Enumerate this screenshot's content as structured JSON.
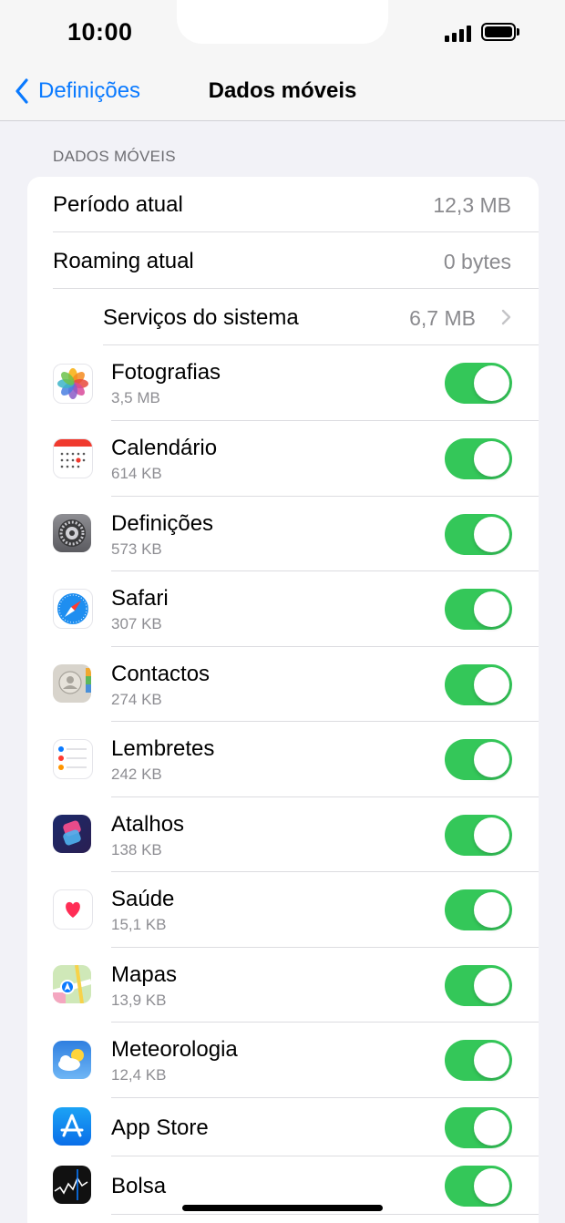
{
  "status": {
    "time": "10:00"
  },
  "nav": {
    "back_label": "Definições",
    "title": "Dados móveis"
  },
  "section": {
    "header": "DADOS MÓVEIS"
  },
  "summary": [
    {
      "label": "Período atual",
      "value": "12,3 MB"
    },
    {
      "label": "Roaming atual",
      "value": "0 bytes"
    }
  ],
  "system_services": {
    "label": "Serviços do sistema",
    "value": "6,7 MB"
  },
  "apps": [
    {
      "name": "Fotografias",
      "size": "3,5 MB",
      "icon": "photos-icon",
      "enabled": true
    },
    {
      "name": "Calendário",
      "size": "614 KB",
      "icon": "calendar-icon",
      "enabled": true
    },
    {
      "name": "Definições",
      "size": "573 KB",
      "icon": "settings-icon",
      "enabled": true
    },
    {
      "name": "Safari",
      "size": "307 KB",
      "icon": "safari-icon",
      "enabled": true
    },
    {
      "name": "Contactos",
      "size": "274 KB",
      "icon": "contacts-icon",
      "enabled": true
    },
    {
      "name": "Lembretes",
      "size": "242 KB",
      "icon": "reminders-icon",
      "enabled": true
    },
    {
      "name": "Atalhos",
      "size": "138 KB",
      "icon": "shortcuts-icon",
      "enabled": true
    },
    {
      "name": "Saúde",
      "size": "15,1 KB",
      "icon": "health-icon",
      "enabled": true
    },
    {
      "name": "Mapas",
      "size": "13,9 KB",
      "icon": "maps-icon",
      "enabled": true
    },
    {
      "name": "Meteorologia",
      "size": "12,4 KB",
      "icon": "weather-icon",
      "enabled": true
    },
    {
      "name": "App Store",
      "icon": "app-store-icon",
      "enabled": true
    },
    {
      "name": "Bolsa",
      "icon": "stocks-icon",
      "enabled": true
    }
  ],
  "colors": {
    "accent": "#0a7aff",
    "toggle_on": "#34c759",
    "background": "#f2f2f7"
  }
}
